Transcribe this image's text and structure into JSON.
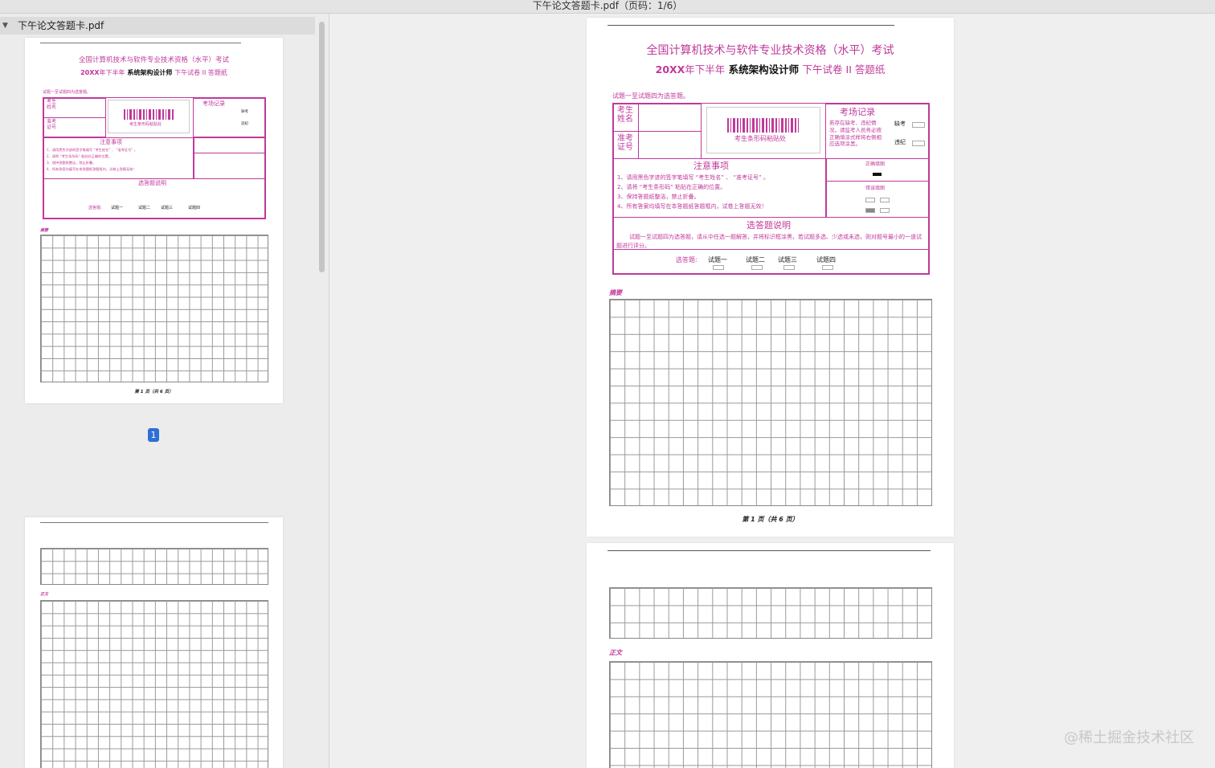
{
  "window": {
    "title": "下午论文答题卡.pdf（页码：1/6）"
  },
  "sidebar": {
    "file_name": "下午论文答题卡.pdf",
    "selected_page": "1"
  },
  "sheet": {
    "exam_title": "全国计算机技术与软件专业技术资格（水平）考试",
    "subtitle_year": "20XX",
    "subtitle_half": "年下半年",
    "subtitle_level": "系统架构设计师",
    "subtitle_paper": "下午试卷 II 答题纸",
    "optional_note": "试题一至试题四为选答题。",
    "name_label": "考生\n姓名",
    "ticket_label": "准考\n证号",
    "barcode_label": "考生条形码粘贴处",
    "room_record_title": "考场记录",
    "room_record_text": "若存在缺考、违纪情况，请监考人员务必按正确填涂式样将右侧相应选项涂黑。",
    "absent_label": "缺考",
    "violation_label": "违纪",
    "notice_title": "注意事项",
    "notice_items": [
      "1、请用黑色字迹的签字笔填写 “考生姓名” 、 “准考证号” 。",
      "2、请将 “考生条形码” 粘贴在正确的位置。",
      "3、保持答题纸整洁，禁止折叠。",
      "4、所有答案均填写在本答题纸答题框内，试卷上答题无效！"
    ],
    "correct_fill_label": "正确填图",
    "wrong_fill_label": "错误填图",
    "choice_title": "选答题说明",
    "choice_text": "试题一至试题四为选答题，请从中任选一题解答，并将标识框涂黑，若试题多选、少选或未选，则对题号最小的一道试题进行评分。",
    "choice_prefix": "选答题:",
    "choices": [
      "试题一",
      "试题二",
      "试题三",
      "试题四"
    ],
    "abstract_label": "摘要",
    "body_label": "正文",
    "page_footer": "第 1 页（共 6 页）"
  },
  "watermark": "@稀土掘金技术社区"
}
